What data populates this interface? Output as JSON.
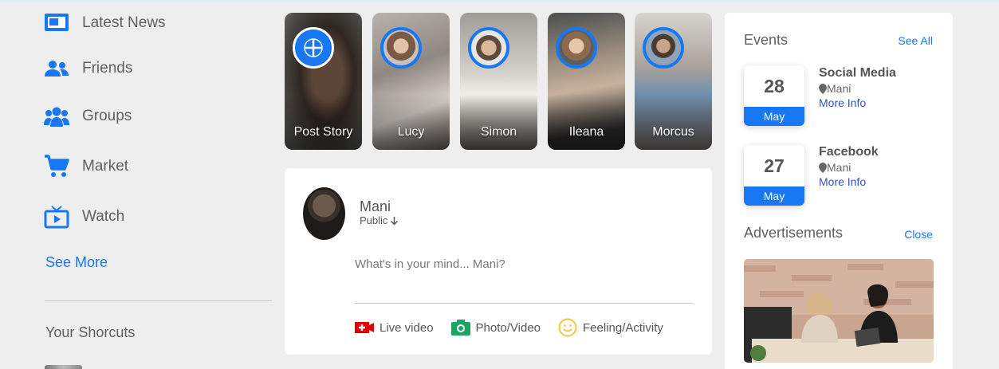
{
  "sidebar": {
    "items": [
      {
        "label": "Latest News",
        "icon": "news-icon"
      },
      {
        "label": "Friends",
        "icon": "friends-icon"
      },
      {
        "label": "Groups",
        "icon": "groups-icon"
      },
      {
        "label": "Market",
        "icon": "cart-icon"
      },
      {
        "label": "Watch",
        "icon": "tv-icon"
      }
    ],
    "see_more": "See More",
    "shortcuts_title": "Your Shorcuts"
  },
  "stories": [
    {
      "name": "Post Story",
      "type": "add"
    },
    {
      "name": "Lucy",
      "type": "user"
    },
    {
      "name": "Simon",
      "type": "user"
    },
    {
      "name": "Ileana",
      "type": "user"
    },
    {
      "name": "Morcus",
      "type": "user"
    }
  ],
  "post": {
    "user_name": "Mani",
    "privacy": "Public",
    "placeholder": "What's in your mind... Mani?",
    "actions": [
      {
        "label": "Live video",
        "icon": "live-video-icon",
        "color": "#e00000"
      },
      {
        "label": "Photo/Video",
        "icon": "camera-icon",
        "color": "#1ea362"
      },
      {
        "label": "Feeling/Activity",
        "icon": "smiley-icon",
        "color": "#f5c542"
      }
    ]
  },
  "events": {
    "title": "Events",
    "see_all": "See All",
    "items": [
      {
        "day": "28",
        "month": "May",
        "title": "Social Media",
        "location": "Mani",
        "more": "More Info"
      },
      {
        "day": "27",
        "month": "May",
        "title": "Facebook",
        "location": "Mani",
        "more": "More Info"
      }
    ]
  },
  "ads": {
    "title": "Advertisements",
    "close": "Close"
  },
  "colors": {
    "accent": "#1877f2",
    "background": "#eeeeee"
  }
}
